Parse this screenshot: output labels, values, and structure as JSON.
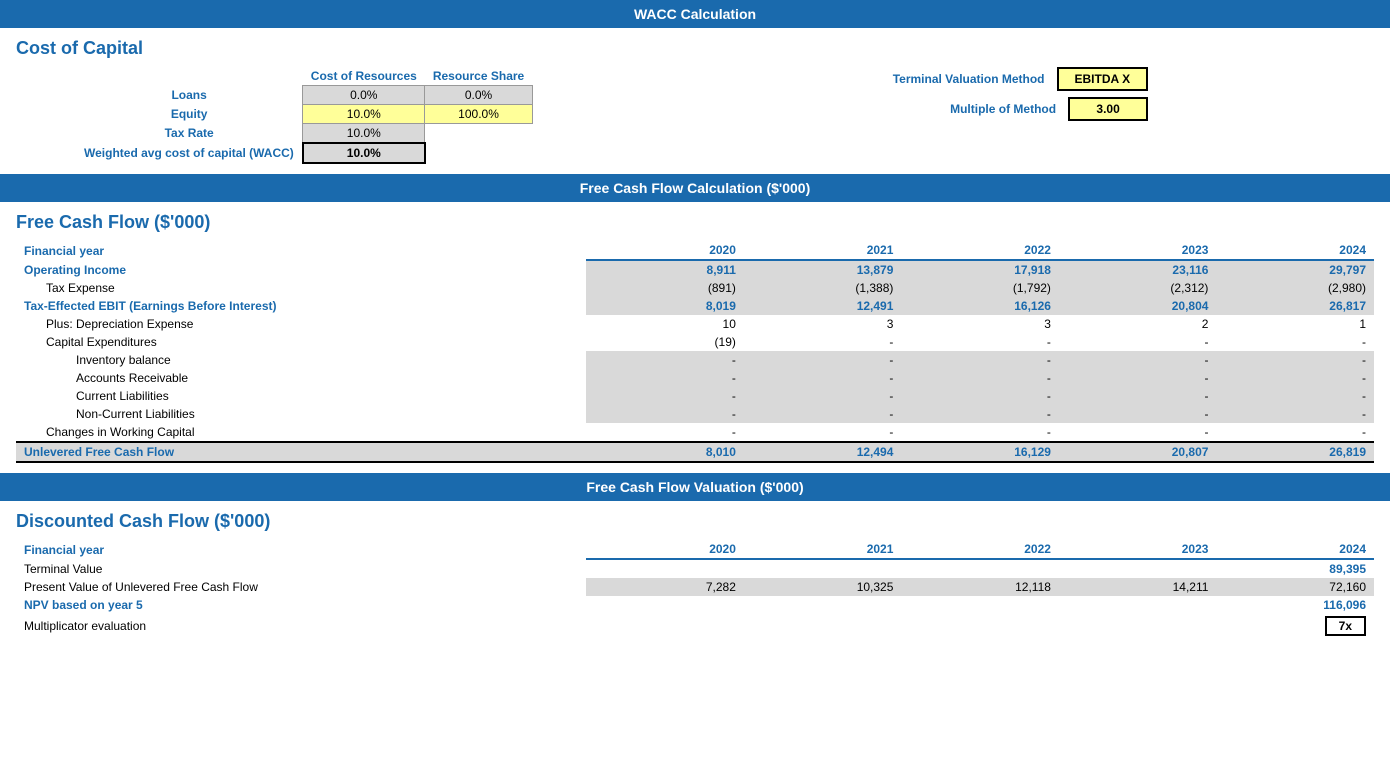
{
  "page": {
    "title": "WACC Calculation",
    "sections": {
      "wacc_header": "WACC Calculation",
      "fcf_header": "Free Cash Flow Calculation ($'000)",
      "fcf_valuation_header": "Free Cash Flow Valuation ($'000)"
    },
    "cost_of_capital": {
      "title": "Cost of Capital",
      "col1": "Cost of Resources",
      "col2": "Resource Share",
      "rows": [
        {
          "label": "Loans",
          "cost": "0.0%",
          "share": "0.0%"
        },
        {
          "label": "Equity",
          "cost": "10.0%",
          "share": "100.0%"
        },
        {
          "label": "Tax Rate",
          "cost": "10.0%",
          "share": ""
        },
        {
          "label": "Weighted avg cost of capital (WACC)",
          "cost": "10.0%",
          "share": ""
        }
      ],
      "terminal_valuation_label": "Terminal Valuation Method",
      "terminal_valuation_value": "EBITDA X",
      "multiple_of_method_label": "Multiple of Method",
      "multiple_of_method_value": "3.00"
    },
    "free_cash_flow": {
      "title": "Free Cash Flow ($'000)",
      "years": [
        "2020",
        "2021",
        "2022",
        "2023",
        "2024"
      ],
      "rows": [
        {
          "label": "Financial year",
          "values": [
            "2020",
            "2021",
            "2022",
            "2023",
            "2024"
          ],
          "style": "header"
        },
        {
          "label": "Operating Income",
          "values": [
            "8,911",
            "13,879",
            "17,918",
            "23,116",
            "29,797"
          ],
          "style": "bold-gray"
        },
        {
          "label": "Tax Expense",
          "values": [
            "(891)",
            "(1,388)",
            "(1,792)",
            "(2,312)",
            "(2,980)"
          ],
          "style": "normal-gray",
          "indent": 1
        },
        {
          "label": "Tax-Effected EBIT (Earnings Before Interest)",
          "values": [
            "8,019",
            "12,491",
            "16,126",
            "20,804",
            "26,817"
          ],
          "style": "bold-gray"
        },
        {
          "label": "Plus: Depreciation Expense",
          "values": [
            "10",
            "3",
            "3",
            "2",
            "1"
          ],
          "style": "normal-white",
          "indent": 1
        },
        {
          "label": "Capital Expenditures",
          "values": [
            "(19)",
            "-",
            "-",
            "-",
            "-"
          ],
          "style": "normal-white",
          "indent": 1
        },
        {
          "label": "Inventory balance",
          "values": [
            "-",
            "-",
            "-",
            "-",
            "-"
          ],
          "style": "normal-gray",
          "indent": 2
        },
        {
          "label": "Accounts Receivable",
          "values": [
            "-",
            "-",
            "-",
            "-",
            "-"
          ],
          "style": "normal-gray",
          "indent": 2
        },
        {
          "label": "Current Liabilities",
          "values": [
            "-",
            "-",
            "-",
            "-",
            "-"
          ],
          "style": "normal-gray",
          "indent": 2
        },
        {
          "label": "Non-Current Liabilities",
          "values": [
            "-",
            "-",
            "-",
            "-",
            "-"
          ],
          "style": "normal-gray",
          "indent": 2
        },
        {
          "label": "Changes in Working Capital",
          "values": [
            "-",
            "-",
            "-",
            "-",
            "-"
          ],
          "style": "normal-white",
          "indent": 1
        },
        {
          "label": "Unlevered Free Cash Flow",
          "values": [
            "8,010",
            "12,494",
            "16,129",
            "20,807",
            "26,819"
          ],
          "style": "total"
        }
      ]
    },
    "discounted_cash_flow": {
      "title": "Discounted Cash Flow ($'000)",
      "rows": [
        {
          "label": "Financial year",
          "values": [
            "2020",
            "2021",
            "2022",
            "2023",
            "2024"
          ],
          "style": "header"
        },
        {
          "label": "Terminal Value",
          "values": [
            "",
            "",
            "",
            "",
            "89,395"
          ],
          "style": "bold-right"
        },
        {
          "label": "Present Value of Unlevered Free Cash Flow",
          "values": [
            "7,282",
            "10,325",
            "12,118",
            "14,211",
            "72,160"
          ],
          "style": "normal-gray"
        },
        {
          "label": "NPV based on year 5",
          "values": [
            "",
            "",
            "",
            "",
            "116,096"
          ],
          "style": "npv"
        },
        {
          "label": "Multiplicator evaluation",
          "values": [
            "",
            "",
            "",
            "",
            "7x"
          ],
          "style": "multiplicator"
        }
      ]
    }
  }
}
